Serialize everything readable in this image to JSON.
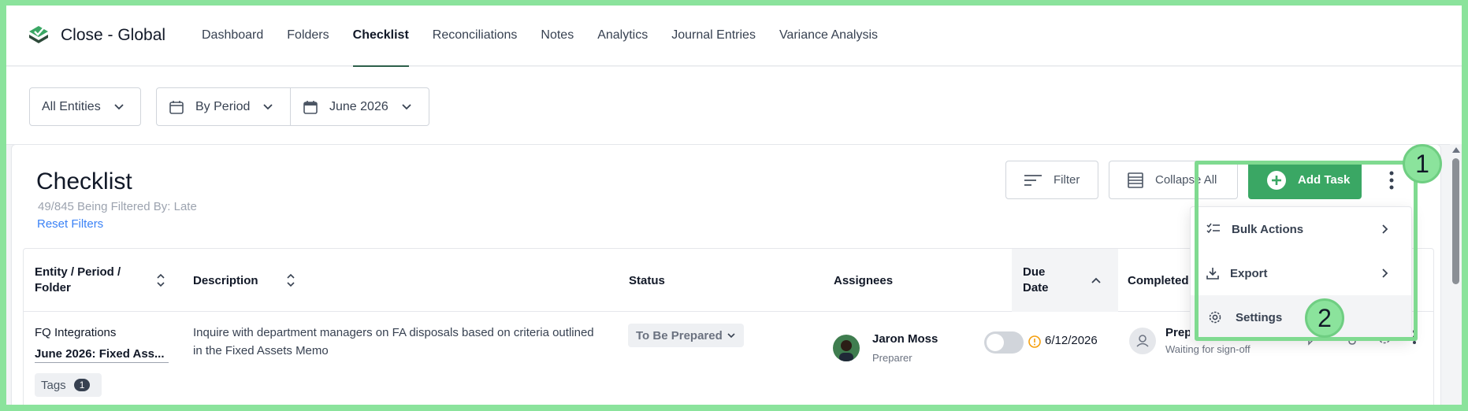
{
  "app": {
    "title": "Close - Global",
    "brand_color": "#3aa764"
  },
  "nav": {
    "tabs": [
      {
        "label": "Dashboard"
      },
      {
        "label": "Folders"
      },
      {
        "label": "Checklist",
        "active": true
      },
      {
        "label": "Reconciliations"
      },
      {
        "label": "Notes"
      },
      {
        "label": "Analytics"
      },
      {
        "label": "Journal Entries"
      },
      {
        "label": "Variance Analysis"
      }
    ]
  },
  "filters": {
    "entities": "All Entities",
    "period_mode": "By Period",
    "period": "June 2026"
  },
  "page": {
    "title": "Checklist",
    "filter_note": "49/845 Being Filtered By: Late",
    "reset_label": "Reset Filters"
  },
  "toolbar": {
    "filter_label": "Filter",
    "collapse_label": "Collapse All",
    "add_task_label": "Add Task"
  },
  "menu": {
    "items": [
      {
        "label": "Bulk Actions",
        "icon": "list-check-icon",
        "has_submenu": true
      },
      {
        "label": "Export",
        "icon": "download-icon",
        "has_submenu": true
      },
      {
        "label": "Settings",
        "icon": "gear-icon",
        "has_submenu": false,
        "hovered": true
      }
    ]
  },
  "table": {
    "columns": [
      "Entity / Period / Folder",
      "Description",
      "Status",
      "Assignees",
      "Due Date",
      "Completed"
    ],
    "rows": [
      {
        "entity": "FQ Integrations",
        "period_folder": "June 2026: Fixed Ass...",
        "tags_label": "Tags",
        "tags_count": "1",
        "description": "Inquire with department managers on FA disposals based on criteria outlined in the Fixed Assets Memo",
        "status": "To Be Prepared",
        "assignee_name": "Jaron Moss",
        "assignee_role": "Preparer",
        "due_date": "6/12/2026",
        "completed_name": "Prep",
        "completed_sub": "Waiting for sign-off"
      }
    ]
  },
  "annotations": {
    "step1": "1",
    "step2": "2",
    "highlight_color": "#7fda90"
  }
}
